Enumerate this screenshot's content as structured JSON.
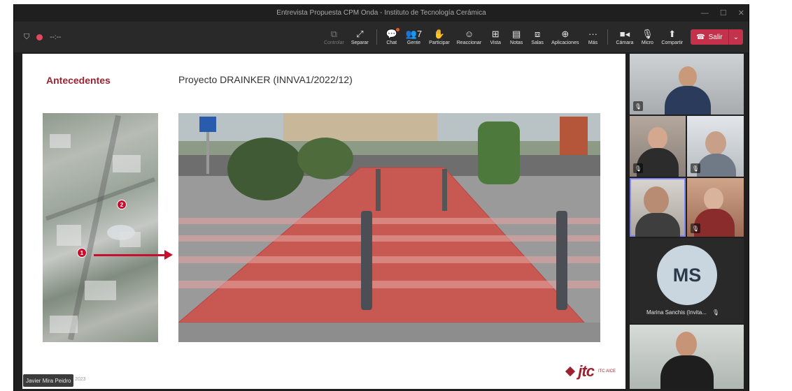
{
  "window": {
    "title": "Entrevista Propuesta CPM Onda - Instituto de Tecnología Cerámica",
    "minimize": "—",
    "maximize": "☐",
    "close": "✕"
  },
  "toolbar": {
    "timer": "--:--",
    "buttons": [
      {
        "label": "Controlar",
        "icon": "⧉",
        "name": "control-button",
        "dim": true
      },
      {
        "label": "Separar",
        "icon": "⤢",
        "name": "pop-out-button"
      },
      {
        "label": "Chat",
        "icon": "💬",
        "name": "chat-button",
        "badge": true
      },
      {
        "label": "Gente",
        "icon": "👥7",
        "name": "people-button"
      },
      {
        "label": "Participar",
        "icon": "✋",
        "name": "raise-hand-button"
      },
      {
        "label": "Reaccionar",
        "icon": "☺",
        "name": "react-button"
      },
      {
        "label": "Vista",
        "icon": "⊞",
        "name": "view-button"
      },
      {
        "label": "Notas",
        "icon": "▤",
        "name": "notes-button"
      },
      {
        "label": "Salas",
        "icon": "⧈",
        "name": "rooms-button"
      },
      {
        "label": "Aplicaciones",
        "icon": "⊕",
        "name": "apps-button"
      },
      {
        "label": "Más",
        "icon": "···",
        "name": "more-button"
      }
    ],
    "media": [
      {
        "label": "Cámara",
        "icon": "■◂",
        "name": "camera-button"
      },
      {
        "label": "Micro",
        "icon": "🎙",
        "name": "mic-button"
      },
      {
        "label": "Compartir",
        "icon": "⬆",
        "name": "share-button"
      }
    ],
    "leave_label": "Salir",
    "leave_icon": "☎",
    "caret": "⌄"
  },
  "slide": {
    "heading": "Antecedentes",
    "title": "Proyecto DRAINKER (INNVA1/2022/12)",
    "marker1": "1",
    "marker2": "2",
    "year": "2023",
    "logo_text": "jtc",
    "logo_small": "ITC AICE"
  },
  "speaker_tag": "Javier Mira Peidro",
  "participants": {
    "ms_initials": "MS",
    "ms_name": "Marina Sanchis (Invita...",
    "mic_off_icon": "🎙"
  },
  "colors": {
    "accent": "#9b2331",
    "leave": "#c4314b",
    "active_outline": "#7f85f5"
  }
}
